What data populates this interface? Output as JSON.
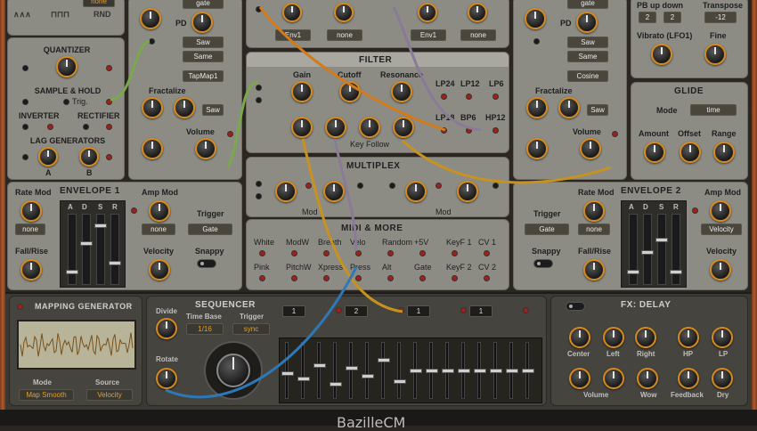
{
  "app_title": "BazilleCM",
  "left": {
    "lfo_labels": [
      "∧∧∧",
      "⊓⊓⊓",
      "RND"
    ],
    "lfo_display": "none",
    "quantizer": "QUANTIZER",
    "sample_hold": "SAMPLE & HOLD",
    "trig": "Trig.",
    "inverter": "INVERTER",
    "rectifier": "RECTIFIER",
    "lag": "LAG GENERATORS",
    "lag_a": "A",
    "lag_b": "B"
  },
  "osc1": {
    "gate": "gate",
    "pd": "PD",
    "wave": "Saw",
    "same": "Same",
    "tapmap": "TapMap1",
    "fractalize": "Fractalize",
    "frac_wave": "Saw",
    "volume": "Volume"
  },
  "osc2": {
    "gate": "gate",
    "pd": "PD",
    "wave": "Saw",
    "same": "Same",
    "cosine": "Cosine",
    "fractalize": "Fractalize",
    "frac_wave": "Saw",
    "volume": "Volume"
  },
  "top_center": {
    "d1": "Env1",
    "d2": "none",
    "d3": "Env1",
    "d4": "none"
  },
  "filter": {
    "title": "FILTER",
    "gain": "Gain",
    "cutoff": "Cutoff",
    "resonance": "Resonance",
    "lp24": "LP24",
    "lp12": "LP12",
    "lp6": "LP6",
    "lp18": "LP18",
    "bp6": "BP6",
    "hp12": "HP12",
    "keyfollow": "Key Follow"
  },
  "multiplex": {
    "title": "MULTIPLEX",
    "mod1": "Mod",
    "mod2": "Mod"
  },
  "midi": {
    "title": "MIDI & MORE",
    "row1": [
      "White",
      "ModW",
      "Breath",
      "Velo",
      "Random",
      "+5V",
      "KeyF 1",
      "CV 1"
    ],
    "row2": [
      "Pink",
      "PitchW",
      "Xpress",
      "Press",
      "Alt",
      "Gate",
      "KeyF 2",
      "CV 2"
    ]
  },
  "env1": {
    "title": "ENVELOPE 1",
    "rate_mod": "Rate Mod",
    "rate_disp": "none",
    "amp_mod": "Amp Mod",
    "amp_disp": "none",
    "trigger": "Trigger",
    "trig_disp": "Gate",
    "adsr": [
      "A",
      "D",
      "S",
      "R"
    ],
    "fall_rise": "Fall/Rise",
    "velocity": "Velocity",
    "snappy": "Snappy"
  },
  "env2": {
    "title": "ENVELOPE 2",
    "rate_mod": "Rate Mod",
    "rate_disp": "none",
    "amp_mod": "Amp Mod",
    "amp_disp": "Velocity",
    "trigger": "Trigger",
    "trig_disp": "Gate",
    "adsr": [
      "A",
      "D",
      "S",
      "R"
    ],
    "fall_rise": "Fall/Rise",
    "velocity": "Velocity",
    "snappy": "Snappy"
  },
  "right": {
    "pb_label": "PB up  down",
    "transpose": "Transpose",
    "pb_up": "2",
    "pb_down": "2",
    "transpose_val": "-12",
    "vibrato": "Vibrato (LFO1)",
    "fine": "Fine",
    "glide": "GLIDE",
    "mode": "Mode",
    "mode_val": "time",
    "amount": "Amount",
    "offset": "Offset",
    "range": "Range"
  },
  "mapping": {
    "title": "MAPPING GENERATOR",
    "mode": "Mode",
    "source": "Source",
    "mode_val": "Map Smooth",
    "source_val": "Velocity"
  },
  "sequencer": {
    "title": "SEQUENCER",
    "divide": "Divide",
    "time_base": "Time Base",
    "trigger": "Trigger",
    "time_val": "1/16",
    "trig_val": "sync",
    "rotate": "Rotate",
    "lanes": [
      "1",
      "2",
      "1",
      "1"
    ],
    "steps": [
      0.45,
      0.35,
      0.6,
      0.25,
      0.55,
      0.4,
      0.7,
      0.3,
      0.5,
      0.5,
      0.5,
      0.5,
      0.5,
      0.5,
      0.5,
      0.5
    ]
  },
  "delay": {
    "title": "FX: DELAY",
    "center": "Center",
    "left": "Left",
    "right": "Right",
    "hp": "HP",
    "lp": "LP",
    "volume": "Volume",
    "wow": "Wow",
    "feedback": "Feedback",
    "dry": "Dry"
  }
}
